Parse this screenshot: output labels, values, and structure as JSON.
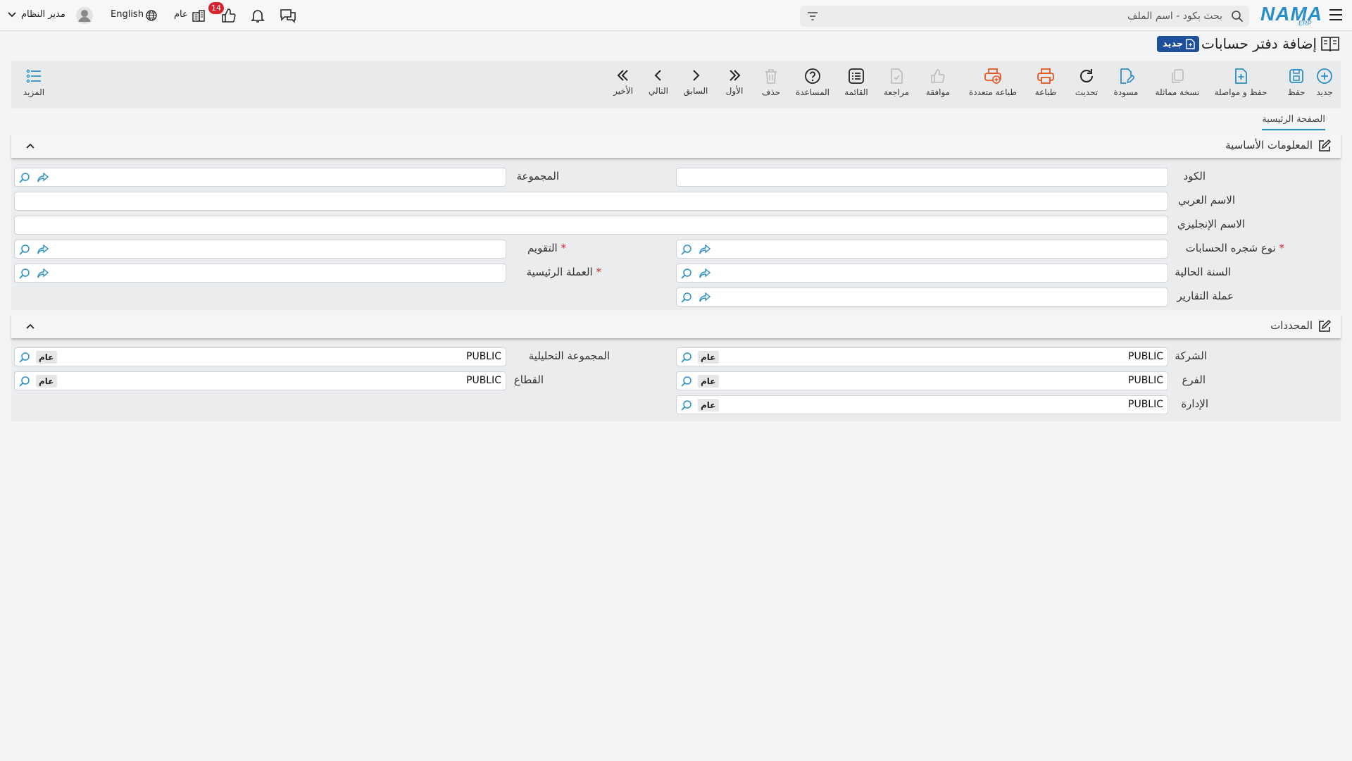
{
  "app": {
    "logo_text": "NAMA",
    "logo_sub": "ERP"
  },
  "header": {
    "search_placeholder": "بحث بكود - اسم الملف",
    "user_name": "مدير النظام",
    "language": "English",
    "branch_label": "عام",
    "likes_count": "14"
  },
  "page": {
    "title": "إضافة دفتر حسابات",
    "status_badge": "جديد"
  },
  "toolbar": {
    "new": "جديد",
    "save": "حفظ",
    "save_continue": "حفظ و مواصلة",
    "duplicate": "نسخة مماثلة",
    "draft": "مسودة",
    "refresh": "تحديث",
    "print": "طباعة",
    "multi_print": "طباعة متعددة",
    "approve": "موافقة",
    "review": "مراجعة",
    "list": "القائمة",
    "help": "المساعدة",
    "delete": "حذف",
    "first": "الأول",
    "previous": "السابق",
    "next": "التالي",
    "last": "الأخير",
    "more": "المزيد"
  },
  "tabs": {
    "home": "الصفحة الرئيسية"
  },
  "basic_info": {
    "title": "المعلومات الأساسية",
    "code_label": "الكود",
    "code_value": "",
    "group_label": "المجموعة",
    "group_value": "",
    "arabic_name_label": "الاسم العربي",
    "arabic_name_value": "",
    "english_name_label": "الاسم الإنجليزي",
    "english_name_value": "",
    "chart_type_label": "نوع شجره الحسابات",
    "chart_type_value": "",
    "calendar_label": "التقويم",
    "calendar_value": "",
    "current_year_label": "السنة الحالية",
    "current_year_value": "",
    "main_currency_label": "العملة الرئيسية",
    "main_currency_value": "",
    "report_currency_label": "عملة التقارير",
    "report_currency_value": "",
    "required_mark": "*"
  },
  "dimensions": {
    "title": "المحددات",
    "company_label": "الشركة",
    "company_value": "PUBLIC",
    "company_tag": "عام",
    "analysis_group_label": "المجموعة التحليلية",
    "analysis_group_value": "PUBLIC",
    "analysis_group_tag": "عام",
    "branch_label": "الفرع",
    "branch_value": "PUBLIC",
    "branch_tag": "عام",
    "sector_label": "القطاع",
    "sector_value": "PUBLIC",
    "sector_tag": "عام",
    "department_label": "الإدارة",
    "department_value": "PUBLIC",
    "department_tag": "عام"
  },
  "colors": {
    "accent": "#2a8fc9",
    "print": "#e8551d",
    "badge": "#d9232e",
    "status_badge": "#1e4f9a"
  }
}
